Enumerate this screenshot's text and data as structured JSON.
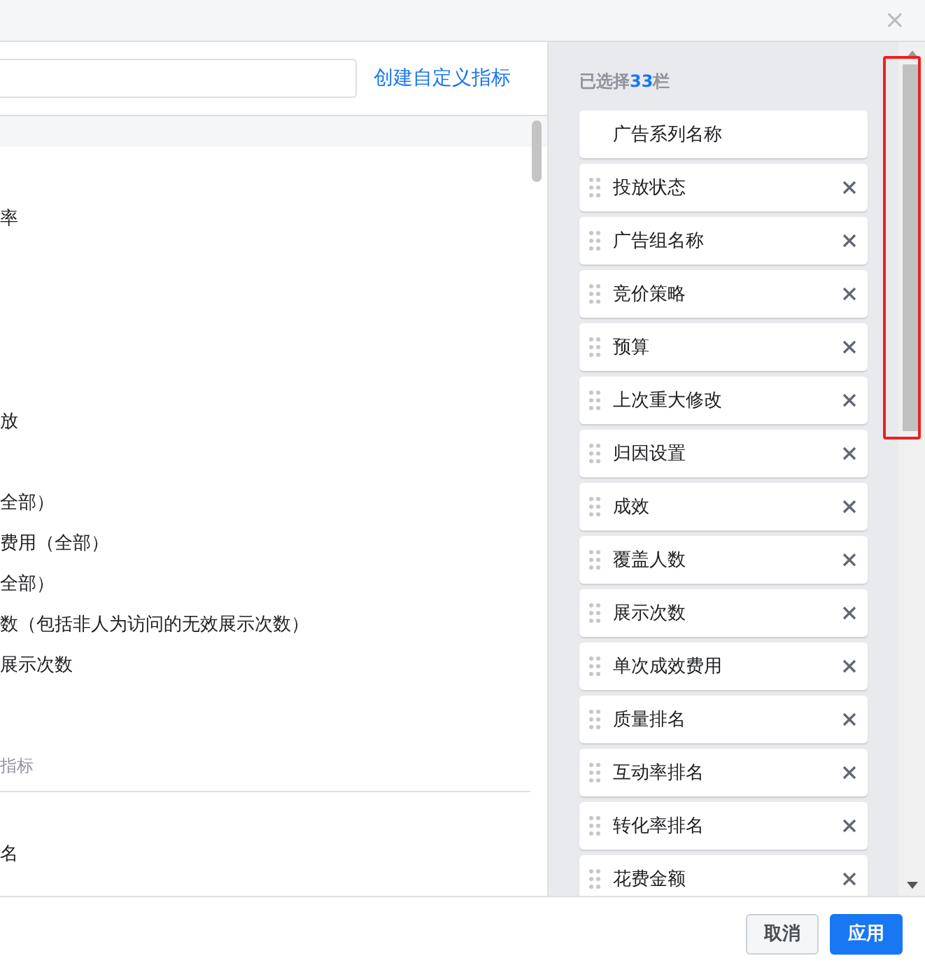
{
  "dialog": {
    "close_label": "×"
  },
  "left_panel": {
    "create_link": "创建自定义指标",
    "rows": [
      {
        "kind": "header"
      },
      {
        "kind": "item"
      },
      {
        "kind": "item",
        "text": "率"
      },
      {
        "kind": "item"
      },
      {
        "kind": "item"
      },
      {
        "kind": "item"
      },
      {
        "kind": "item"
      },
      {
        "kind": "item",
        "text": "放"
      },
      {
        "kind": "item"
      },
      {
        "kind": "item",
        "text": "全部）"
      },
      {
        "kind": "item",
        "text": "费用（全部）"
      },
      {
        "kind": "item",
        "text": "全部）"
      },
      {
        "kind": "item",
        "text": "数（包括非人为访问的无效展示次数）"
      },
      {
        "kind": "item",
        "text": "展示次数"
      },
      {
        "kind": "item"
      },
      {
        "kind": "section",
        "text": "指标"
      },
      {
        "kind": "item"
      },
      {
        "kind": "item",
        "text": "名"
      }
    ]
  },
  "right_panel": {
    "title_prefix": "已选择",
    "count": "33",
    "title_suffix": "栏",
    "columns": [
      {
        "label": "广告系列名称",
        "removable": false
      },
      {
        "label": "投放状态",
        "removable": true
      },
      {
        "label": "广告组名称",
        "removable": true
      },
      {
        "label": "竞价策略",
        "removable": true
      },
      {
        "label": "预算",
        "removable": true
      },
      {
        "label": "上次重大修改",
        "removable": true
      },
      {
        "label": "归因设置",
        "removable": true
      },
      {
        "label": "成效",
        "removable": true
      },
      {
        "label": "覆盖人数",
        "removable": true
      },
      {
        "label": "展示次数",
        "removable": true
      },
      {
        "label": "单次成效费用",
        "removable": true
      },
      {
        "label": "质量排名",
        "removable": true
      },
      {
        "label": "互动率排名",
        "removable": true
      },
      {
        "label": "转化率排名",
        "removable": true
      },
      {
        "label": "花费金额",
        "removable": true
      }
    ]
  },
  "footer": {
    "buttons": [
      {
        "label": "取消",
        "kind": "secondary"
      },
      {
        "label": "应用",
        "kind": "primary"
      }
    ]
  }
}
